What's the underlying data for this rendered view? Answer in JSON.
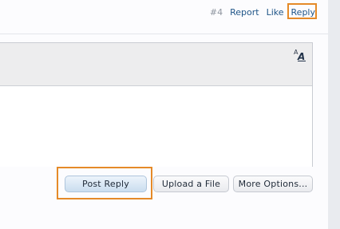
{
  "post": {
    "number": "#4",
    "actions": {
      "report": "Report",
      "like": "Like",
      "reply": "Reply"
    }
  },
  "editor": {
    "font_size_toggle": {
      "small": "A",
      "large": "A"
    },
    "text_value": ""
  },
  "buttons": {
    "post_reply": "Post Reply",
    "upload_file": "Upload a File",
    "more_options": "More Options..."
  },
  "highlight_color": "#e58a28"
}
